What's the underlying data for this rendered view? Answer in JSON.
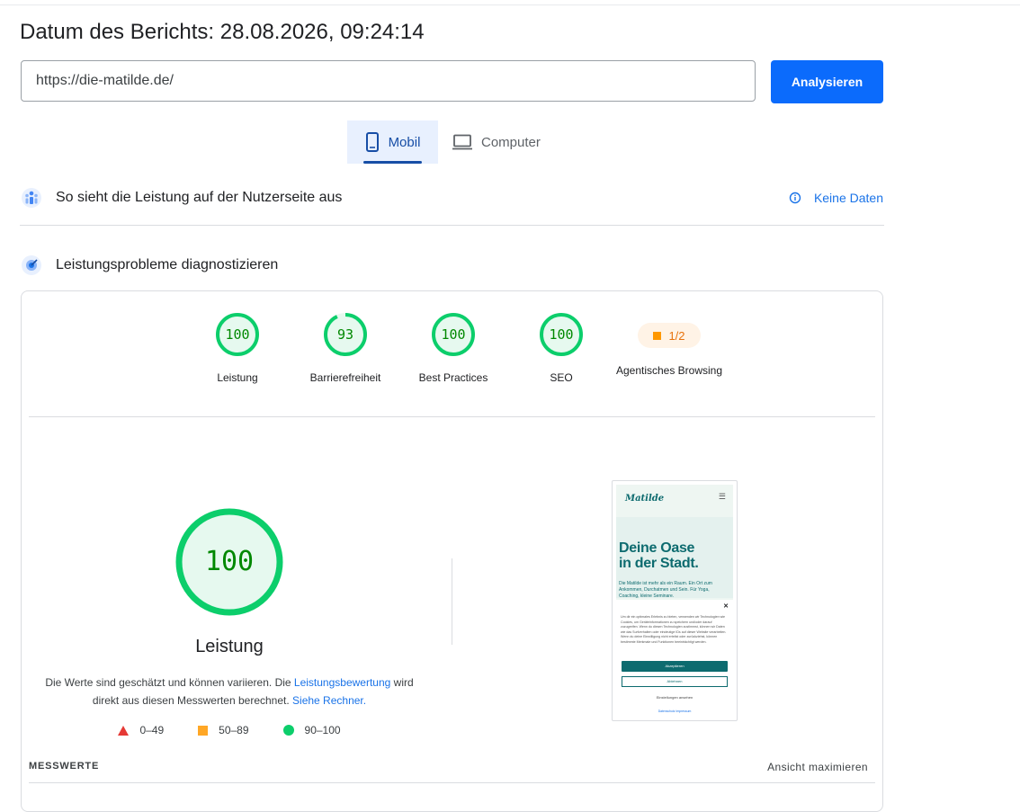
{
  "header": {
    "report_date": "Datum des Berichts: 28.08.2026, 09:24:14",
    "url_value": "https://die-matilde.de/",
    "analyze_label": "Analysieren"
  },
  "tabs": [
    {
      "label": "Mobil",
      "icon": "phone-icon",
      "selected": true
    },
    {
      "label": "Computer",
      "icon": "laptop-icon",
      "selected": false
    }
  ],
  "user_experience": {
    "title": "So sieht die Leistung auf der Nutzerseite aus",
    "status": "Keine Daten",
    "icon": "field-data-icon"
  },
  "diagnose": {
    "title": "Leistungsprobleme diagnostizieren",
    "icon": "lab-data-icon"
  },
  "categories": [
    {
      "label": "Leistung",
      "score": "100",
      "value": 100
    },
    {
      "label": "Barrierefreiheit",
      "score": "93",
      "value": 93
    },
    {
      "label": "Best Practices",
      "score": "100",
      "value": 100
    },
    {
      "label": "SEO",
      "score": "100",
      "value": 100
    },
    {
      "label": "Agentisches Browsing",
      "score": "1/2"
    }
  ],
  "performance": {
    "score": "100",
    "value": 100,
    "title": "Leistung",
    "desc_part1": "Die Werte sind geschätzt und können variieren. Die ",
    "link1": "Leistungsbewertung",
    "desc_part2": " wird direkt aus diesen Messwerten berechnet. ",
    "link2": "Siehe Rechner."
  },
  "legend": [
    {
      "range": "0–49",
      "shape": "triangle",
      "color": "#e53935"
    },
    {
      "range": "50–89",
      "shape": "square",
      "color": "#ffa726"
    },
    {
      "range": "90–100",
      "shape": "circle",
      "color": "#0cce6b"
    }
  ],
  "screenshot": {
    "logo": "Matilde",
    "headline_1": "Deine Oase",
    "headline_2": "in der Stadt.",
    "text": "Die Matilde ist mehr als ein Raum. Ein Ort zum Ankommen, Durchatmen und Sein. Für Yoga, Coaching, kleine Seminare.",
    "consent_text": "Um dir ein optimales Erlebnis zu bieten, verwenden wir Technologien wie Cookies, um Geräteinformationen zu speichern und/oder darauf zuzugreifen. Wenn du diesen Technologien zustimmst, können wir Daten wie das Surfverhalten oder eindeutige IDs auf dieser Website verarbeiten. Wenn du deine Einwilligung nicht erteilst oder zurückziehst, können bestimmte Merkmale und Funktionen beeinträchtigt werden.",
    "accept": "Akzeptieren",
    "decline": "Ablehnen",
    "settings": "Einstellungen ansehen",
    "footer_links": "Datenschutz   Impressum"
  },
  "metrics": {
    "label": "MESSWERTE",
    "expand": "Ansicht maximieren"
  },
  "colors": {
    "pass": "#0cce6b",
    "pass_text": "#008800",
    "pass_bg": "#e6f9ef",
    "accent": "#0b6bfc",
    "link": "#1a73e8"
  }
}
